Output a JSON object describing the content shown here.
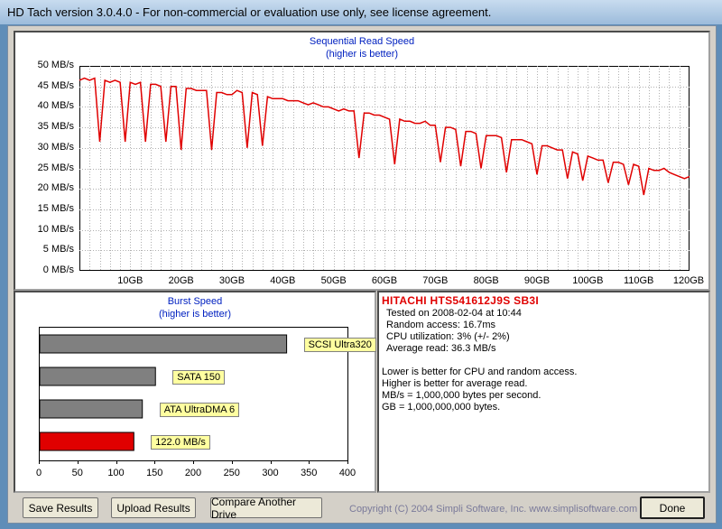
{
  "window": {
    "title": "HD Tach version 3.0.4.0  - For non-commercial or evaluation use only, see license agreement."
  },
  "sequential": {
    "title": "Sequential Read Speed",
    "subtitle": "(higher is better)",
    "y_ticks": [
      "50 MB/s",
      "45 MB/s",
      "40 MB/s",
      "35 MB/s",
      "30 MB/s",
      "25 MB/s",
      "20 MB/s",
      "15 MB/s",
      "10 MB/s",
      "5 MB/s",
      "0 MB/s"
    ],
    "x_ticks": [
      "10GB",
      "20GB",
      "30GB",
      "40GB",
      "50GB",
      "60GB",
      "70GB",
      "80GB",
      "90GB",
      "100GB",
      "110GB",
      "120GB"
    ]
  },
  "burst": {
    "title": "Burst Speed",
    "subtitle": "(higher is better)",
    "x_ticks": [
      "0",
      "50",
      "100",
      "150",
      "200",
      "250",
      "300",
      "350",
      "400"
    ]
  },
  "info": {
    "drive": "HITACHI HTS541612J9S SB3I",
    "lines": [
      "Tested on 2008-02-04 at 10:44",
      "Random access: 16.7ms",
      "CPU utilization: 3% (+/- 2%)",
      "Average read: 36.3 MB/s"
    ],
    "notes": [
      "Lower is better for CPU and random access.",
      "Higher is better for average read.",
      "MB/s = 1,000,000 bytes per second.",
      "GB = 1,000,000,000 bytes."
    ]
  },
  "buttons": {
    "save": "Save Results",
    "upload": "Upload Results",
    "compare": "Compare Another Drive",
    "done": "Done"
  },
  "copyright": "Copyright (C) 2004 Simpli Software, Inc. www.simplisoftware.com",
  "chart_data": [
    {
      "type": "line",
      "title": "Sequential Read Speed",
      "subtitle": "(higher is better)",
      "xlabel": "",
      "ylabel": "",
      "xlim": [
        0,
        120
      ],
      "ylim": [
        0,
        50
      ],
      "grid": true,
      "color": "#e00000",
      "x_ticks": [
        10,
        20,
        30,
        40,
        50,
        60,
        70,
        80,
        90,
        100,
        110,
        120
      ],
      "y_ticks": [
        0,
        5,
        10,
        15,
        20,
        25,
        30,
        35,
        40,
        45,
        50
      ],
      "series": [
        {
          "x": [
            0,
            1,
            2,
            3,
            4,
            5,
            6,
            7,
            8,
            9,
            10,
            11,
            12,
            13,
            14,
            15,
            16,
            17,
            18,
            19,
            20,
            21,
            22,
            23,
            24,
            25,
            26,
            27,
            28,
            29,
            30,
            31,
            32,
            33,
            34,
            35,
            36,
            37,
            38,
            39,
            40,
            41,
            42,
            43,
            44,
            45,
            46,
            47,
            48,
            49,
            50,
            51,
            52,
            53,
            54,
            55,
            56,
            57,
            58,
            59,
            60,
            61,
            62,
            63,
            64,
            65,
            66,
            67,
            68,
            69,
            70,
            71,
            72,
            73,
            74,
            75,
            76,
            77,
            78,
            79,
            80,
            81,
            82,
            83,
            84,
            85,
            86,
            87,
            88,
            89,
            90,
            91,
            92,
            93,
            94,
            95,
            96,
            97,
            98,
            99,
            100,
            101,
            102,
            103,
            104,
            105,
            106,
            107,
            108,
            109,
            110,
            111,
            112,
            113,
            114,
            115,
            116,
            117,
            118,
            119,
            120
          ],
          "values": [
            46.5,
            47.0,
            46.5,
            47.0,
            31.5,
            46.5,
            46.0,
            46.5,
            46.0,
            31.5,
            46.0,
            45.5,
            46.0,
            31.5,
            45.5,
            45.5,
            45.0,
            31.5,
            45.0,
            45.0,
            29.5,
            44.5,
            44.5,
            44.0,
            44.0,
            44.0,
            29.5,
            43.5,
            43.5,
            43.0,
            43.0,
            44.0,
            43.5,
            30.0,
            43.5,
            43.0,
            30.5,
            42.5,
            42.0,
            42.0,
            42.0,
            41.5,
            41.5,
            41.5,
            41.0,
            40.5,
            41.0,
            40.5,
            40.0,
            40.0,
            39.5,
            39.0,
            39.5,
            39.0,
            39.0,
            27.5,
            38.5,
            38.5,
            38.0,
            38.0,
            37.5,
            37.0,
            26.0,
            37.0,
            36.5,
            36.5,
            36.0,
            36.0,
            36.5,
            35.5,
            35.5,
            26.5,
            35.0,
            35.0,
            34.5,
            25.5,
            34.0,
            34.0,
            33.5,
            25.0,
            33.0,
            33.0,
            33.0,
            32.5,
            24.0,
            32.0,
            32.0,
            32.0,
            31.5,
            31.0,
            23.5,
            30.5,
            30.5,
            30.0,
            29.5,
            29.5,
            22.5,
            29.0,
            28.5,
            22.0,
            28.0,
            27.5,
            27.0,
            27.0,
            21.5,
            26.5,
            26.5,
            26.0,
            21.0,
            26.0,
            25.5,
            18.5,
            25.0,
            24.5,
            24.5,
            25.0,
            24.0,
            23.5,
            23.0,
            22.5,
            23.0
          ]
        }
      ]
    },
    {
      "type": "bar",
      "orientation": "horizontal",
      "title": "Burst Speed",
      "subtitle": "(higher is better)",
      "xlim": [
        0,
        400
      ],
      "x_ticks": [
        0,
        50,
        100,
        150,
        200,
        250,
        300,
        350,
        400
      ],
      "categories": [
        "SCSI Ultra320",
        "SATA 150",
        "ATA UltraDMA 6",
        "122.0 MB/s"
      ],
      "values": [
        320,
        150,
        133,
        122
      ],
      "colors": [
        "#808080",
        "#808080",
        "#808080",
        "#e00000"
      ]
    }
  ]
}
